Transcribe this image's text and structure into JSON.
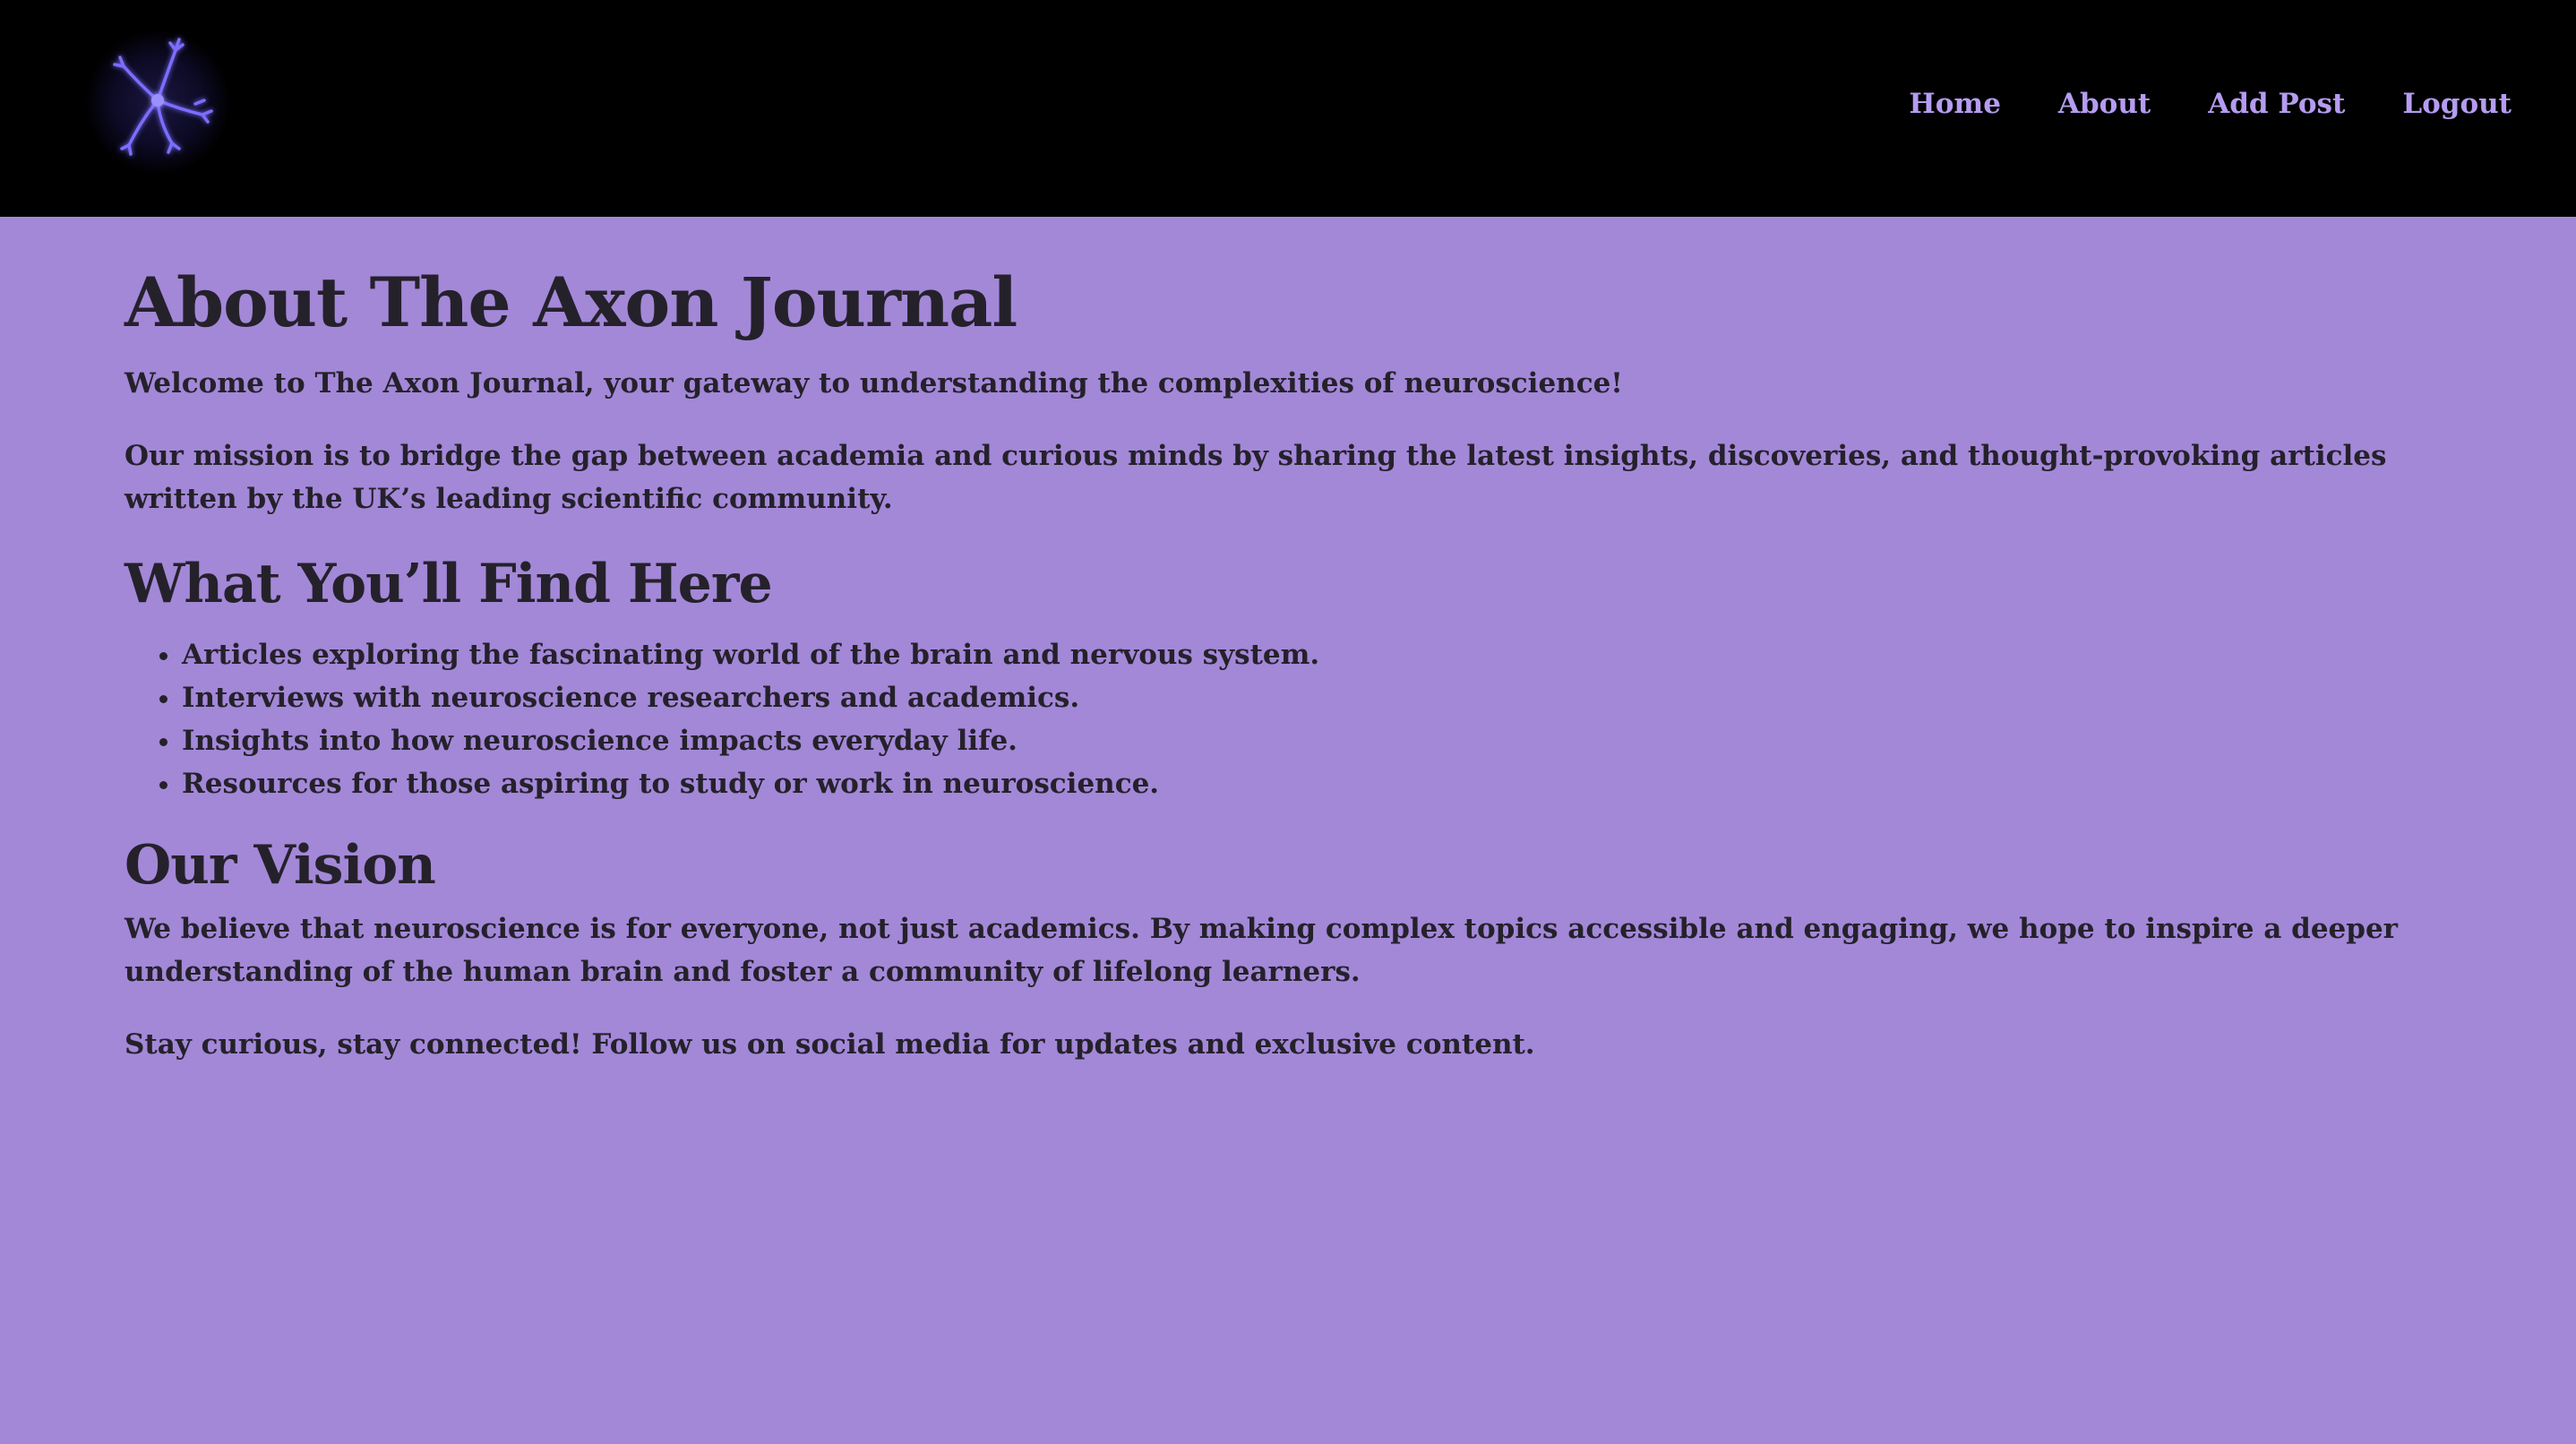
{
  "header": {
    "logo_icon": "neuron-icon",
    "nav": {
      "home": "Home",
      "about": "About",
      "add_post": "Add Post",
      "logout": "Logout"
    }
  },
  "main": {
    "title": "About The Axon Journal",
    "welcome": "Welcome to The Axon Journal, your gateway to understanding the complexities of neuroscience!",
    "mission": "Our mission is to bridge the gap between academia and curious minds by sharing the latest insights, discoveries, and thought-provoking articles written by the UK’s leading scientific community.",
    "find_heading": "What You’ll Find Here",
    "find_items": [
      "Articles exploring the fascinating world of the brain and nervous system.",
      "Interviews with neuroscience researchers and academics.",
      "Insights into how neuroscience impacts everyday life.",
      "Resources for those aspiring to study or work in neuroscience."
    ],
    "vision_heading": "Our Vision",
    "vision_text": "We believe that neuroscience is for everyone, not just academics. By making complex topics accessible and engaging, we hope to inspire a deeper understanding of the human brain and foster a community of lifelong learners.",
    "closing": "Stay curious, stay connected! Follow us on social media for updates and exclusive content."
  },
  "colors": {
    "background": "#a388d8",
    "navbar": "#000000",
    "nav_link": "#b59cf0",
    "text": "#25212b",
    "logo_glow": "#6b5cff"
  }
}
